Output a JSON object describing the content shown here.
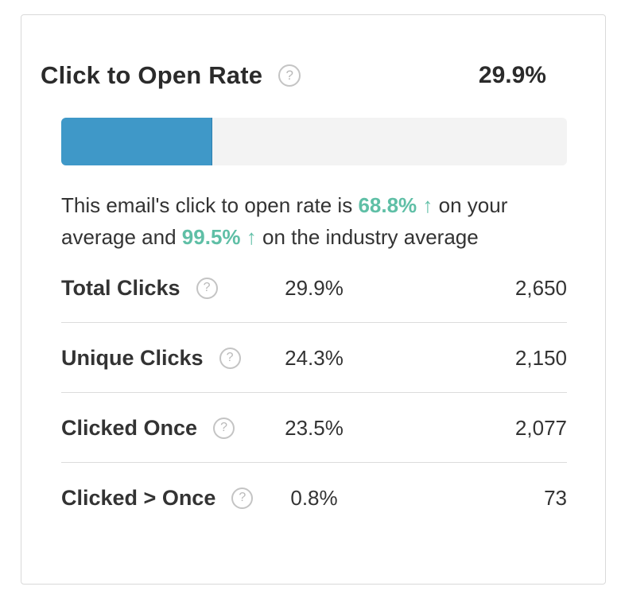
{
  "card": {
    "title": "Click to Open Rate",
    "help_symbol": "?",
    "rate_value": "29.9%",
    "progress_fraction": 0.299,
    "accent_color": "#3f98c8",
    "positive_color": "#5fbfa6"
  },
  "summary": {
    "prefix": "This email's click to open rate is ",
    "your_average_value": "68.8%",
    "your_average_arrow": "↑",
    "middle": " on your average and ",
    "industry_value": "99.5%",
    "industry_arrow": "↑",
    "suffix": " on the industry average"
  },
  "stats": [
    {
      "label": "Total Clicks",
      "percent": "29.9%",
      "count": "2,650"
    },
    {
      "label": "Unique Clicks",
      "percent": "24.3%",
      "count": "2,150"
    },
    {
      "label": "Clicked Once",
      "percent": "23.5%",
      "count": "2,077"
    },
    {
      "label": "Clicked > Once",
      "percent": "0.8%",
      "count": "73"
    }
  ]
}
